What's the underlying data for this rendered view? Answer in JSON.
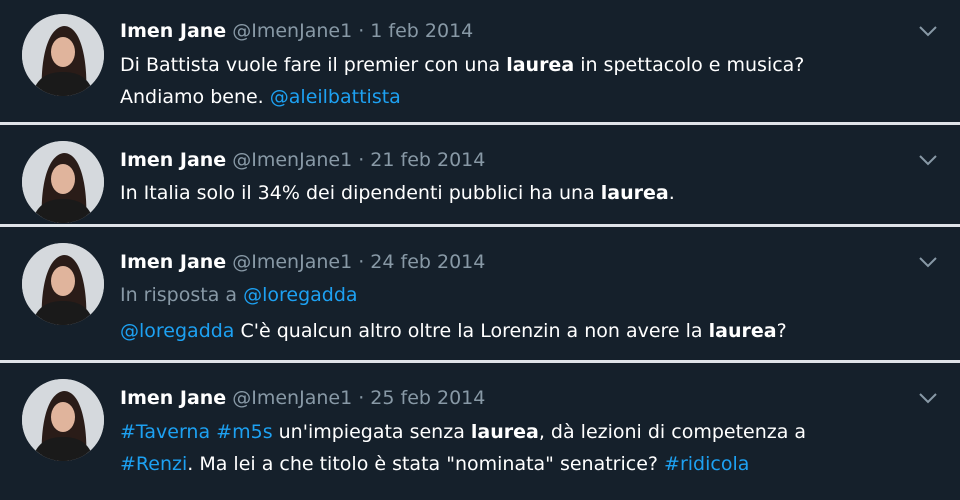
{
  "tweets": [
    {
      "name": "Imen Jane",
      "handle": "@ImenJane1",
      "sep": " · ",
      "date": "1 feb 2014",
      "line1_a": "Di Battista vuole fare il premier con una ",
      "line1_bold": "laurea",
      "line1_b": " in spettacolo e musica?",
      "line2_a": "Andiamo bene. ",
      "line2_link": "@aleilbattista"
    },
    {
      "name": "Imen Jane",
      "handle": "@ImenJane1",
      "sep": " · ",
      "date": "21 feb 2014",
      "line1_a": "In Italia solo il 34% dei dipendenti pubblici ha una ",
      "line1_bold": "laurea",
      "line1_b": "."
    },
    {
      "name": "Imen Jane",
      "handle": "@ImenJane1",
      "sep": " · ",
      "date": "24 feb 2014",
      "reply_prefix": "In risposta a ",
      "reply_handle": "@loregadda",
      "line1_link": "@loregadda",
      "line1_a": " C'è qualcun altro oltre la Lorenzin a non avere la ",
      "line1_bold": "laurea",
      "line1_b": "?"
    },
    {
      "name": "Imen Jane",
      "handle": "@ImenJane1",
      "sep": " · ",
      "date": "25 feb 2014",
      "line1_tag1": "#Taverna",
      "line1_space": " ",
      "line1_tag2": "#m5s",
      "line1_a": " un'impiegata senza ",
      "line1_bold": "laurea",
      "line1_b": ", dà lezioni di competenza a",
      "line2_tag": "#Renzi",
      "line2_a": ". Ma lei a che titolo è stata \"nominata\" senatrice? ",
      "line2_tag2": "#ridicola"
    }
  ]
}
